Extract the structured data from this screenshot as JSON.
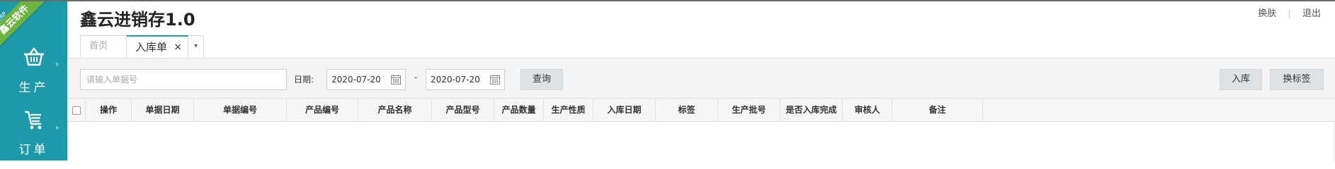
{
  "brand": {
    "ribbon_tag": "ERP",
    "ribbon_name": "鑫云软件",
    "ribbon_color": "#6db33f",
    "sidebar_color": "#1d9aaa"
  },
  "sidebar": {
    "items": [
      {
        "label": "生产",
        "icon": "basket-icon"
      },
      {
        "label": "订单",
        "icon": "cart-list-icon"
      }
    ]
  },
  "header": {
    "title": "鑫云进销存1.0",
    "links": [
      "换肤",
      "退出"
    ]
  },
  "tabs": {
    "home": "首页",
    "active": "入库单",
    "close": "×",
    "more": "▾"
  },
  "toolbar": {
    "search_placeholder": "请输入单据号",
    "date_label": "日期:",
    "date_start": "2020-07-20",
    "date_dash": "-",
    "date_end": "2020-07-20",
    "query": "查询",
    "stock_in": "入库",
    "change_label": "换标签"
  },
  "table": {
    "columns": [
      "操作",
      "单据日期",
      "单据编号",
      "产品编号",
      "产品名称",
      "产品型号",
      "产品数量",
      "生产性质",
      "入库日期",
      "标签",
      "生产批号",
      "是否入库完成",
      "审核人",
      "备注"
    ]
  }
}
